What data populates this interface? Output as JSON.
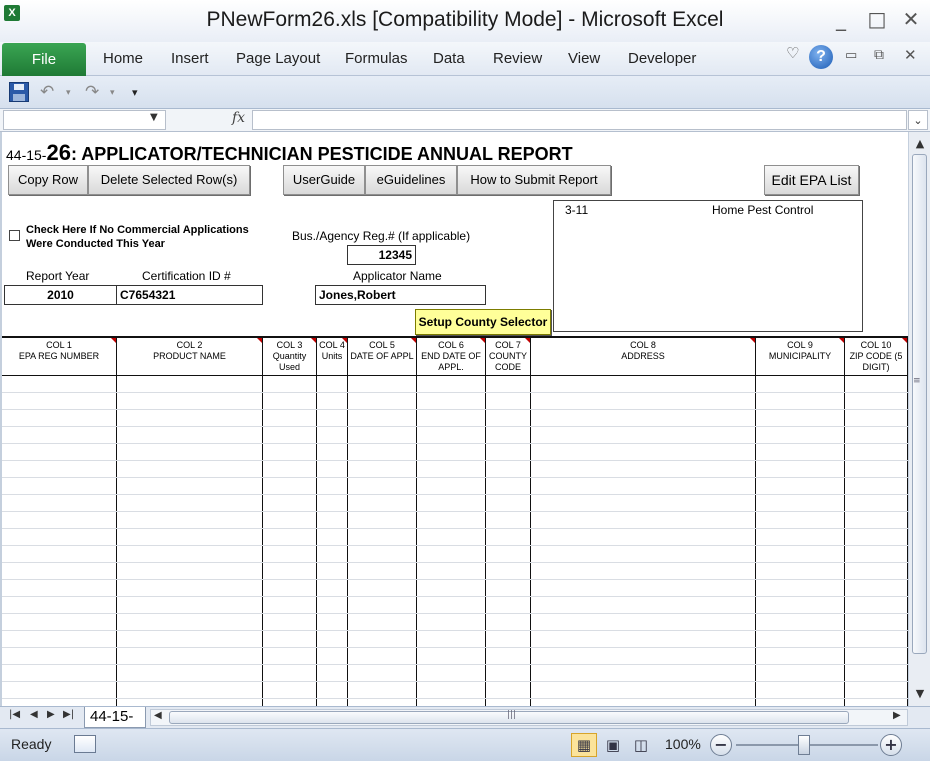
{
  "window": {
    "title": "PNewForm26.xls  [Compatibility Mode] - Microsoft Excel",
    "app_icon": "X",
    "controls": [
      "_",
      "□",
      "✕"
    ]
  },
  "ribbon": {
    "file_tab": "File",
    "tabs": [
      "Home",
      "Insert",
      "Page Layout",
      "Formulas",
      "Data",
      "Review",
      "View",
      "Developer"
    ],
    "help": "?"
  },
  "formula_bar": {
    "fx": "fx",
    "name_box": "",
    "content": ""
  },
  "sheet": {
    "title_prefix": "44-15-",
    "title_number": "26",
    "title_rest": ": APPLICATOR/TECHNICIAN PESTICIDE ANNUAL REPORT",
    "buttons": {
      "copy_row": "Copy Row",
      "delete_rows": "Delete Selected Row(s)",
      "user_guide": "UserGuide",
      "eguidelines": "eGuidelines",
      "how_to_submit": "How to Submit Report",
      "edit_epa": "Edit EPA List",
      "setup_county": "Setup County Selector"
    },
    "no_commercial_label": "Check Here If No Commercial Applications Were Conducted This Year",
    "bus_agency_label": "Bus./Agency Reg.# (If applicable)",
    "bus_agency_value": "12345",
    "report_year_label": "Report Year",
    "report_year_value": "2010",
    "cert_id_label": "Certification ID #",
    "cert_id_value": "C7654321",
    "applicator_label": "Applicator Name",
    "applicator_value": "Jones,Robert",
    "epa_list": [
      {
        "code": "3-11",
        "name": "Home Pest Control"
      }
    ],
    "columns": [
      {
        "num": "COL 1",
        "name": "EPA REG NUMBER"
      },
      {
        "num": "COL 2",
        "name": "PRODUCT NAME"
      },
      {
        "num": "COL 3",
        "name": "Quantity Used"
      },
      {
        "num": "COL 4",
        "name": "Units"
      },
      {
        "num": "COL 5",
        "name": "DATE OF APPL"
      },
      {
        "num": "COL 6",
        "name": "END DATE OF APPL."
      },
      {
        "num": "COL 7",
        "name": "COUNTY CODE"
      },
      {
        "num": "COL 8",
        "name": "ADDRESS"
      },
      {
        "num": "COL 9",
        "name": "MUNICIPALITY"
      },
      {
        "num": "COL 10",
        "name": "ZIP CODE (5 DIGIT)"
      }
    ]
  },
  "sheet_tabs": {
    "active_tab": "44-15-"
  },
  "status_bar": {
    "status": "Ready",
    "zoom": "100%"
  }
}
